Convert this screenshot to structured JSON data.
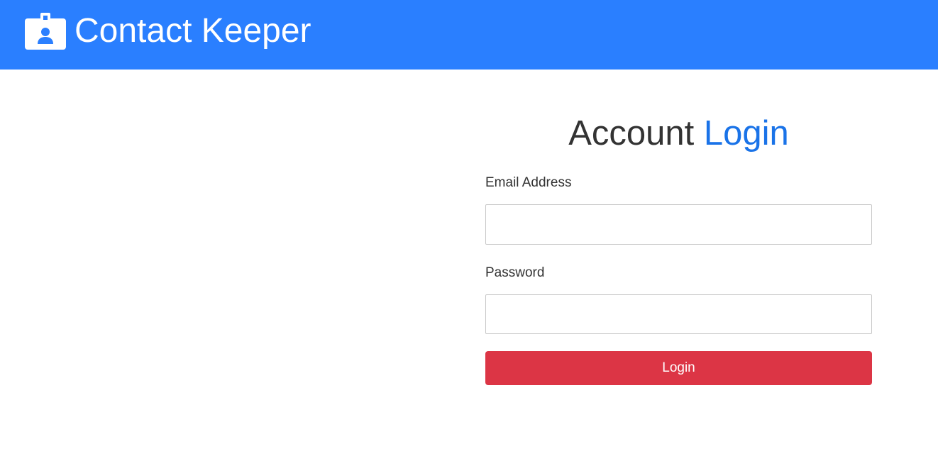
{
  "app": {
    "title": "Contact Keeper",
    "brand_icon": "id-badge-icon",
    "brand_color": "#2a7fff"
  },
  "login": {
    "heading_prefix": "Account",
    "heading_accent": "Login",
    "heading_accent_color": "#1a73e8",
    "email_label": "Email Address",
    "email_value": "",
    "password_label": "Password",
    "password_value": "",
    "submit_label": "Login",
    "submit_color": "#dc3545"
  }
}
